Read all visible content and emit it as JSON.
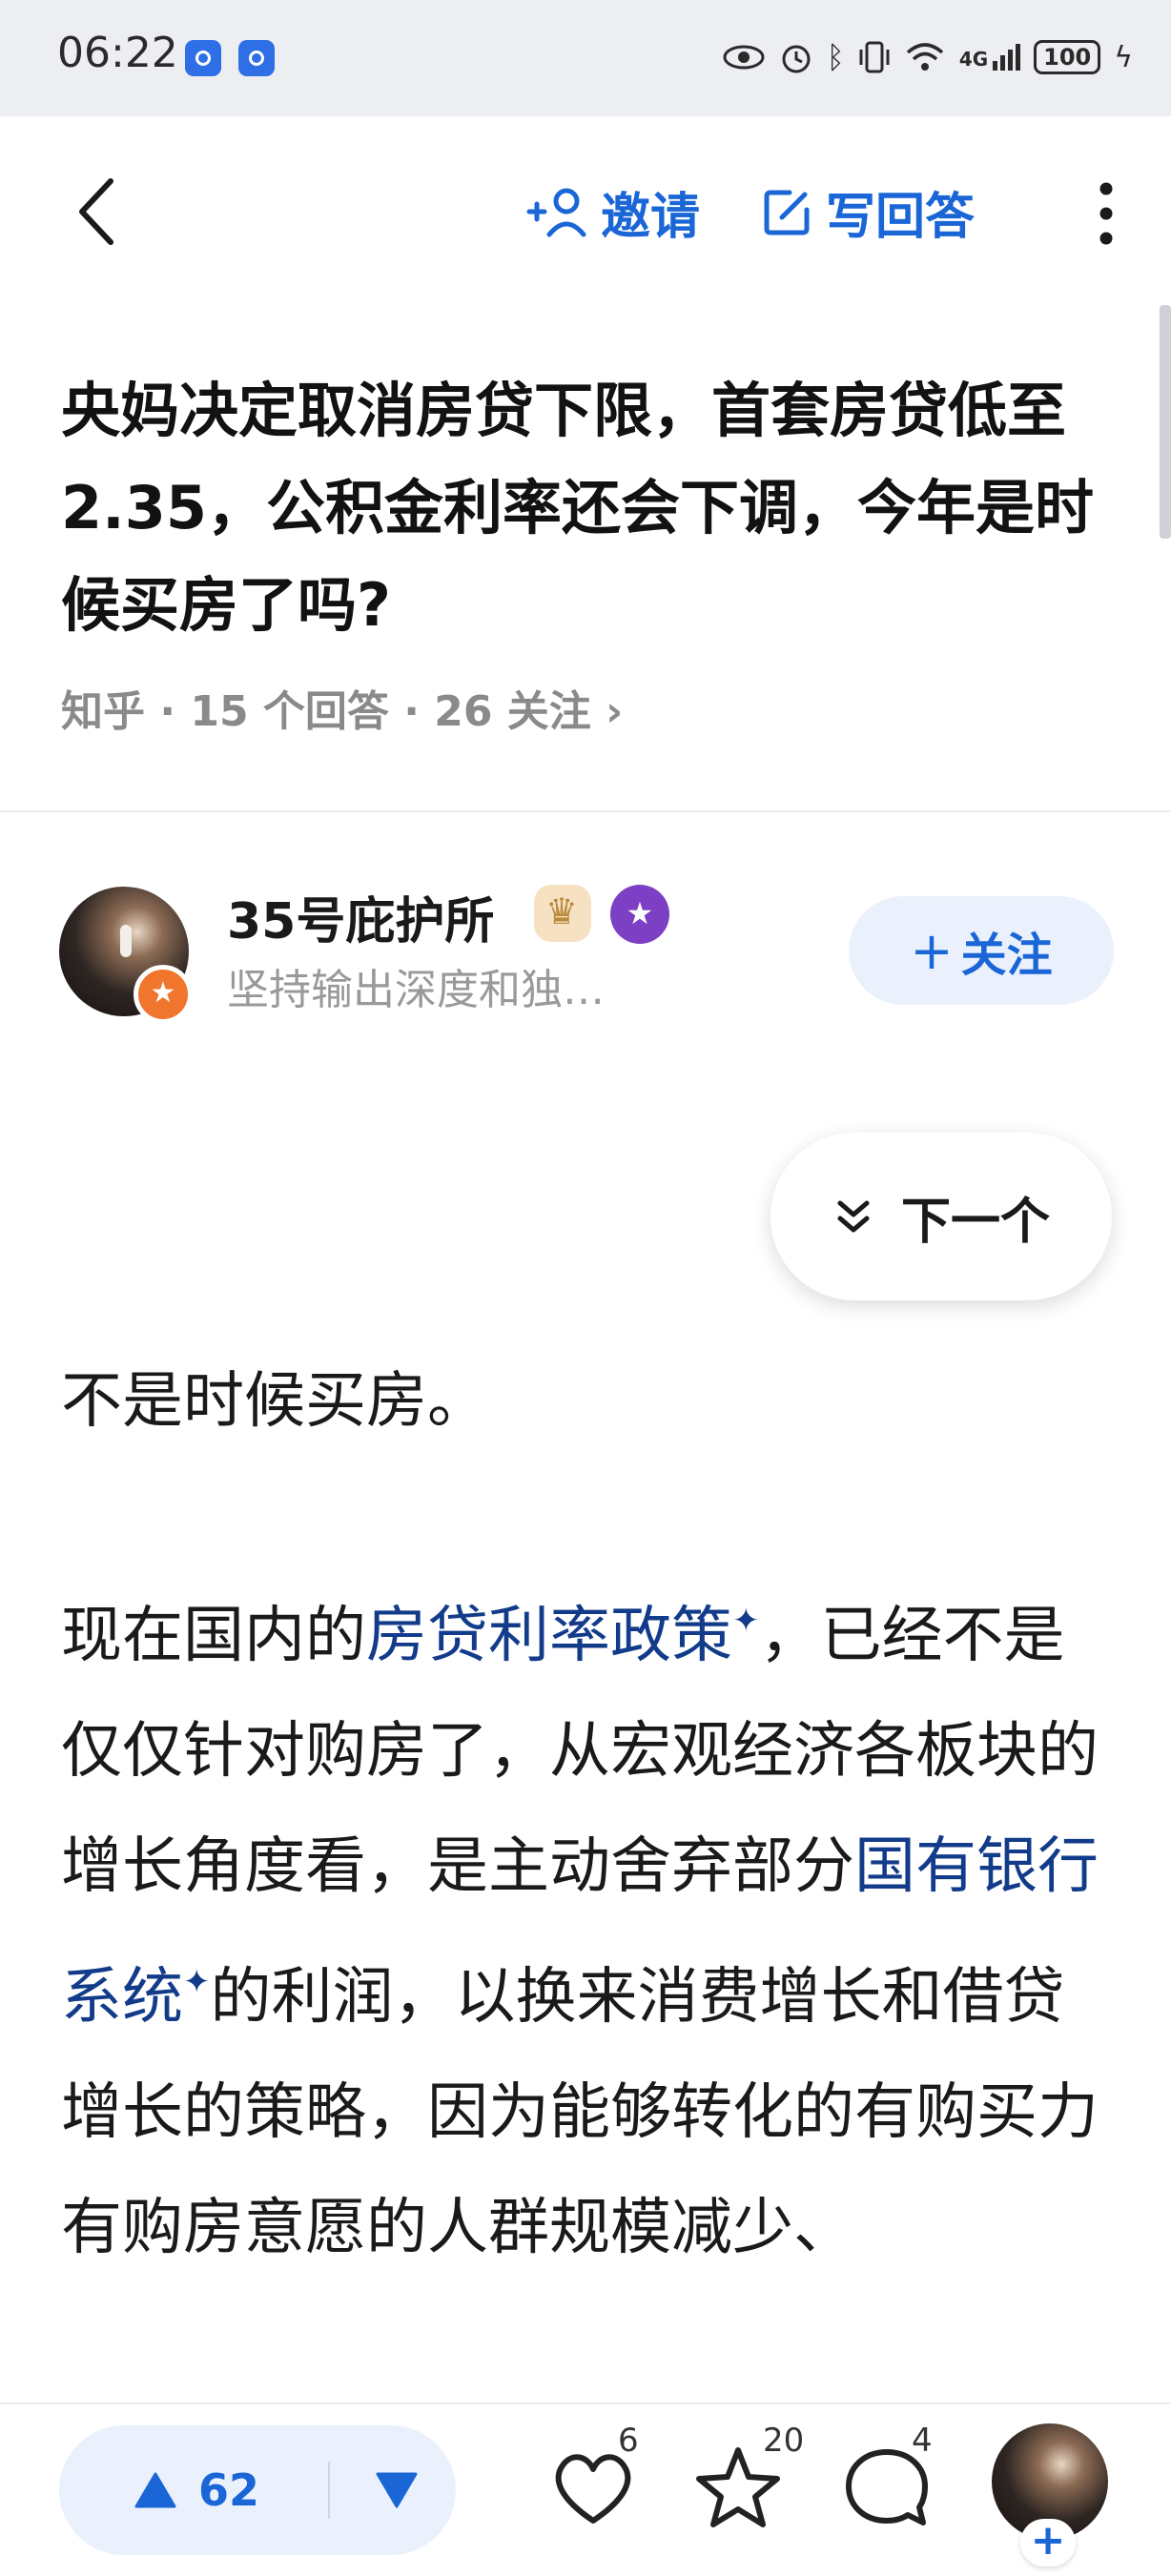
{
  "status_bar": {
    "time": "06:22",
    "network": "4G",
    "battery": "100"
  },
  "top_bar": {
    "invite_label": "邀请",
    "write_answer_label": "写回答"
  },
  "question": {
    "title": "央妈决定取消房贷下限，首套房贷低至2.35，公积金利率还会下调，今年是时候买房了吗?",
    "meta": "知乎 · 15 个回答 · 26 关注 ›"
  },
  "author": {
    "name": "35号庇护所",
    "bio": "坚持输出深度和独…",
    "follow_label": "关注"
  },
  "next_button": {
    "label": "下一个"
  },
  "answer": {
    "p1": "不是时候买房。",
    "p2_a": "现在国内的",
    "link1": "房贷利率政策",
    "p2_b": "，已经不是仅仅针对购房了，从宏观经济各板块的增长角度看，是主动舍弃部分",
    "link2": "国有银行系统",
    "p2_c": "的利润，以换来消费增长和借贷增长的策略，因为能够转化的有购买力有购房意愿的人群规模减少、"
  },
  "bottom_bar": {
    "upvotes": "62",
    "likes": "6",
    "favorites": "20",
    "comments": "4"
  },
  "colors": {
    "accent": "#1a66d6",
    "link": "#123b8a",
    "status_bg": "#edeef2"
  }
}
